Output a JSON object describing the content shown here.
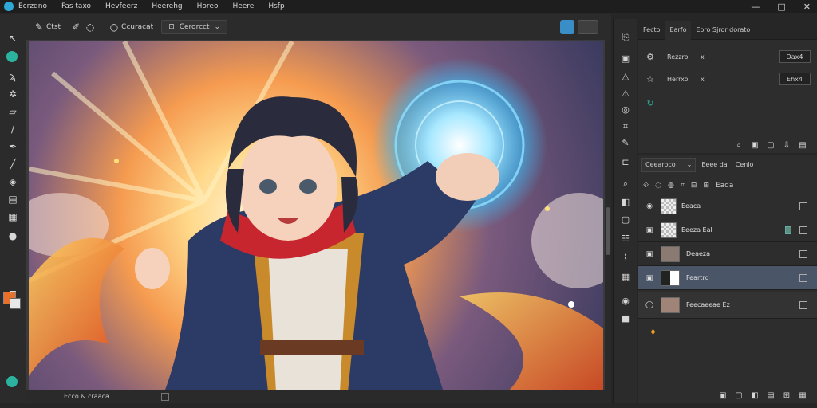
{
  "menubar": {
    "items": [
      "Ecrzdno",
      "Fas taxo",
      "Hevfeerz",
      "Heerehg",
      "Horeo",
      "Heere",
      "Hsfp"
    ],
    "window_controls": [
      "—",
      "□",
      "✕"
    ]
  },
  "options": {
    "brush_label": "Ctst",
    "mode_label": "Ccuracat",
    "preset_label": "Cerorcct",
    "preset_chevron": "⌄"
  },
  "canvas": {
    "status_text": "Ecco & craaca"
  },
  "props_panel": {
    "tabs": [
      "Fecto",
      "Earfo",
      "Eoro Sjror dorato"
    ],
    "rows": [
      {
        "label": "Rezzro",
        "x": "x",
        "value": "Dax4"
      },
      {
        "label": "Herrxo",
        "x": "x",
        "value": "Ehx4"
      }
    ]
  },
  "layers_panel": {
    "blend_mode": "Ceearoco",
    "blend_chevron": "⌄",
    "tabs": [
      "Eeee da",
      "Cenlo"
    ],
    "filter_label": "Eada",
    "layers": [
      {
        "name": "Eeaca"
      },
      {
        "name": "Eeeza Eal"
      },
      {
        "name": "Deaeza"
      },
      {
        "name": "Feartrd"
      },
      {
        "name": "Feecaeeae Ez"
      }
    ]
  },
  "colors": {
    "accent": "#2fa8d8",
    "selected_layer": "#4b5568",
    "foreground_swatch": "#e8702a",
    "teal_tool": "#2bb3a0"
  }
}
